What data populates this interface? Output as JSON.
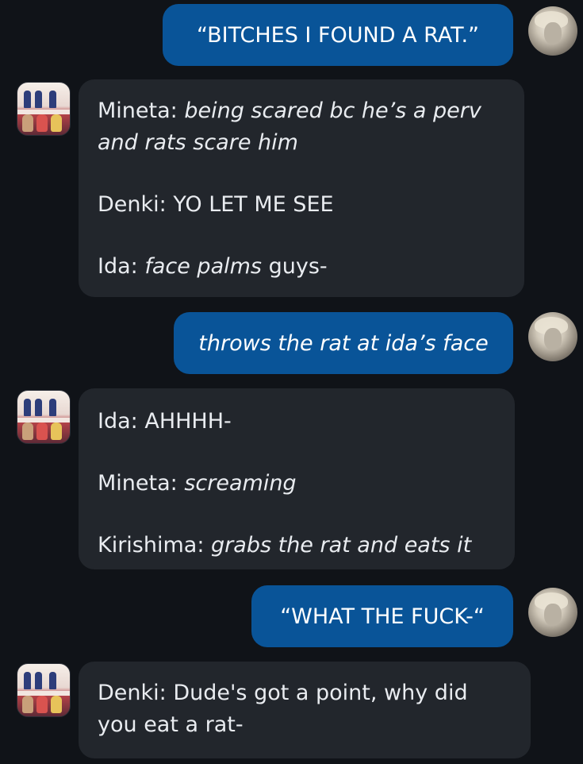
{
  "conversation": {
    "messages": [
      {
        "role": "user",
        "text": "“BITCHES I FOUND A RAT.”"
      },
      {
        "role": "bot",
        "lines": [
          {
            "speaker": "Mineta:",
            "action": "being scared bc he’s a perv and rats scare him",
            "plain": ""
          },
          {
            "speaker": "Denki:",
            "action": "",
            "plain": "YO LET ME SEE"
          },
          {
            "speaker": "Ida:",
            "action": "face palms",
            "plain": "guys-"
          }
        ]
      },
      {
        "role": "user",
        "text": "throws the rat at ida’s face"
      },
      {
        "role": "bot",
        "lines": [
          {
            "speaker": "Ida:",
            "action": "",
            "plain": "AHHHH-"
          },
          {
            "speaker": "Mineta:",
            "action": "screaming",
            "plain": ""
          },
          {
            "speaker": "Kirishima:",
            "action": "grabs the rat and eats it",
            "plain": ""
          }
        ]
      },
      {
        "role": "user",
        "text": "“WHAT THE FUCK-“"
      },
      {
        "role": "bot",
        "lines": [
          {
            "speaker": "Denki:",
            "action": "",
            "plain": "Dude's got a point, why did you eat a rat-"
          }
        ]
      }
    ]
  },
  "avatars": {
    "user": "user-avatar-icon",
    "bot": "character-group-avatar-icon"
  },
  "colors": {
    "background": "#101318",
    "user_bubble": "#095498",
    "bot_bubble": "#22262c",
    "text": "#e9ecf0"
  }
}
